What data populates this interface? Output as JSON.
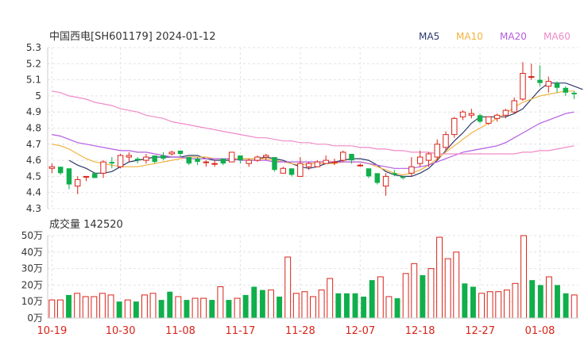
{
  "header": {
    "title": "中国西电[SH601179] 2024-01-12"
  },
  "legend": [
    {
      "label": "MA5",
      "color": "#2f3a6b"
    },
    {
      "label": "MA10",
      "color": "#f2b33d"
    },
    {
      "label": "MA20",
      "color": "#b45de0"
    },
    {
      "label": "MA60",
      "color": "#f08ac9"
    }
  ],
  "volume_panel": {
    "title": "成交量 142520"
  },
  "colors": {
    "up": "#d9241a",
    "down": "#0faf4b"
  },
  "chart_data": [
    {
      "type": "candlestick",
      "ylim": [
        4.3,
        5.3
      ],
      "y_ticks": [
        "5.3",
        "5.2",
        "5.1",
        "5",
        "4.9",
        "4.8",
        "4.7",
        "4.6",
        "4.5",
        "4.4",
        "4.3"
      ],
      "x_tick_labels": [
        "10-19",
        "10-30",
        "11-08",
        "11-17",
        "11-28",
        "12-07",
        "12-18",
        "12-27",
        "01-08"
      ],
      "x_tick_indices": [
        0,
        8,
        15,
        22,
        29,
        36,
        43,
        50,
        57
      ],
      "ohlc": [
        [
          4.55,
          4.58,
          4.52,
          4.56
        ],
        [
          4.56,
          4.55,
          4.51,
          4.52
        ],
        [
          4.55,
          4.47,
          4.42,
          4.45
        ],
        [
          4.44,
          4.5,
          4.39,
          4.48
        ],
        [
          4.5,
          4.5,
          4.47,
          4.5
        ],
        [
          4.52,
          4.52,
          4.49,
          4.49
        ],
        [
          4.52,
          4.6,
          4.49,
          4.59
        ],
        [
          4.59,
          4.62,
          4.55,
          4.58
        ],
        [
          4.56,
          4.64,
          4.55,
          4.63
        ],
        [
          4.62,
          4.65,
          4.59,
          4.63
        ],
        [
          4.61,
          4.62,
          4.58,
          4.6
        ],
        [
          4.6,
          4.64,
          4.58,
          4.62
        ],
        [
          4.63,
          4.63,
          4.58,
          4.59
        ],
        [
          4.63,
          4.65,
          4.6,
          4.61
        ],
        [
          4.64,
          4.66,
          4.63,
          4.65
        ],
        [
          4.66,
          4.66,
          4.62,
          4.64
        ],
        [
          4.62,
          4.62,
          4.57,
          4.58
        ],
        [
          4.61,
          4.62,
          4.57,
          4.59
        ],
        [
          4.59,
          4.6,
          4.56,
          4.59
        ],
        [
          4.58,
          4.6,
          4.56,
          4.58
        ],
        [
          4.61,
          4.61,
          4.57,
          4.58
        ],
        [
          4.59,
          4.65,
          4.59,
          4.65
        ],
        [
          4.63,
          4.63,
          4.58,
          4.6
        ],
        [
          4.58,
          4.61,
          4.56,
          4.6
        ],
        [
          4.6,
          4.63,
          4.59,
          4.62
        ],
        [
          4.62,
          4.64,
          4.6,
          4.63
        ],
        [
          4.62,
          4.62,
          4.53,
          4.54
        ],
        [
          4.52,
          4.56,
          4.52,
          4.55
        ],
        [
          4.55,
          4.55,
          4.5,
          4.51
        ],
        [
          4.5,
          4.62,
          4.5,
          4.58
        ],
        [
          4.56,
          4.59,
          4.54,
          4.58
        ],
        [
          4.56,
          4.6,
          4.56,
          4.59
        ],
        [
          4.58,
          4.63,
          4.58,
          4.6
        ],
        [
          4.59,
          4.61,
          4.57,
          4.59
        ],
        [
          4.6,
          4.66,
          4.59,
          4.65
        ],
        [
          4.64,
          4.64,
          4.58,
          4.6
        ],
        [
          4.57,
          4.58,
          4.56,
          4.57
        ],
        [
          4.55,
          4.55,
          4.49,
          4.5
        ],
        [
          4.52,
          4.52,
          4.45,
          4.46
        ],
        [
          4.44,
          4.52,
          4.38,
          4.5
        ],
        [
          4.52,
          4.54,
          4.5,
          4.51
        ],
        [
          4.5,
          4.5,
          4.48,
          4.49
        ],
        [
          4.52,
          4.62,
          4.5,
          4.56
        ],
        [
          4.58,
          4.66,
          4.56,
          4.62
        ],
        [
          4.6,
          4.65,
          4.56,
          4.64
        ],
        [
          4.62,
          4.73,
          4.6,
          4.7
        ],
        [
          4.68,
          4.78,
          4.66,
          4.76
        ],
        [
          4.76,
          4.87,
          4.74,
          4.86
        ],
        [
          4.87,
          4.91,
          4.85,
          4.9
        ],
        [
          4.88,
          4.92,
          4.86,
          4.89
        ],
        [
          4.88,
          4.89,
          4.83,
          4.84
        ],
        [
          4.83,
          4.87,
          4.82,
          4.87
        ],
        [
          4.86,
          4.89,
          4.84,
          4.88
        ],
        [
          4.88,
          4.92,
          4.86,
          4.91
        ],
        [
          4.9,
          4.99,
          4.89,
          4.97
        ],
        [
          4.98,
          5.21,
          4.97,
          5.14
        ],
        [
          5.12,
          5.2,
          5.1,
          5.12
        ],
        [
          5.1,
          5.19,
          5.06,
          5.08
        ],
        [
          5.06,
          5.12,
          5.02,
          5.09
        ],
        [
          5.08,
          5.09,
          5.02,
          5.05
        ],
        [
          5.05,
          5.06,
          5.0,
          5.02
        ],
        [
          5.02,
          5.03,
          4.98,
          5.01
        ]
      ],
      "ma": {
        "MA5": {
          "start": 2,
          "values": [
            4.6,
            4.57,
            4.55,
            4.52,
            4.52,
            4.53,
            4.56,
            4.59,
            4.6,
            4.61,
            4.62,
            4.62,
            4.62,
            4.62,
            4.63,
            4.63,
            4.61,
            4.6,
            4.6,
            4.6,
            4.61,
            4.61,
            4.61,
            4.62,
            4.61,
            4.6,
            4.58,
            4.56,
            4.55,
            4.56,
            4.58,
            4.59,
            4.6,
            4.61,
            4.61,
            4.6,
            4.57,
            4.53,
            4.51,
            4.5,
            4.5,
            4.52,
            4.55,
            4.6,
            4.66,
            4.72,
            4.77,
            4.83,
            4.87,
            4.87,
            4.87,
            4.87,
            4.89,
            4.92,
            4.98,
            5.04,
            5.08,
            5.08,
            5.08,
            5.06,
            5.04
          ]
        },
        "MA10": {
          "start": 0,
          "values": [
            4.7,
            4.69,
            4.67,
            4.64,
            4.61,
            4.59,
            4.58,
            4.57,
            4.56,
            4.56,
            4.56,
            4.57,
            4.58,
            4.59,
            4.6,
            4.61,
            4.62,
            4.62,
            4.62,
            4.61,
            4.61,
            4.61,
            4.61,
            4.61,
            4.61,
            4.61,
            4.6,
            4.59,
            4.58,
            4.57,
            4.58,
            4.58,
            4.58,
            4.58,
            4.59,
            4.59,
            4.59,
            4.58,
            4.56,
            4.54,
            4.52,
            4.51,
            4.52,
            4.54,
            4.57,
            4.61,
            4.65,
            4.69,
            4.73,
            4.77,
            4.8,
            4.83,
            4.86,
            4.89,
            4.93,
            4.96,
            4.98,
            5.0,
            5.01,
            5.02,
            5.03,
            5.03
          ]
        },
        "MA20": {
          "start": 0,
          "values": [
            4.76,
            4.75,
            4.73,
            4.71,
            4.7,
            4.69,
            4.68,
            4.67,
            4.66,
            4.66,
            4.65,
            4.65,
            4.64,
            4.63,
            4.62,
            4.62,
            4.61,
            4.61,
            4.61,
            4.61,
            4.61,
            4.61,
            4.6,
            4.6,
            4.6,
            4.6,
            4.59,
            4.59,
            4.59,
            4.59,
            4.59,
            4.59,
            4.59,
            4.59,
            4.59,
            4.59,
            4.59,
            4.58,
            4.57,
            4.56,
            4.55,
            4.55,
            4.55,
            4.56,
            4.57,
            4.59,
            4.61,
            4.63,
            4.65,
            4.66,
            4.67,
            4.68,
            4.69,
            4.71,
            4.74,
            4.77,
            4.8,
            4.83,
            4.85,
            4.87,
            4.89,
            4.9
          ]
        },
        "MA60": {
          "start": 0,
          "values": [
            5.03,
            5.02,
            5.0,
            4.99,
            4.98,
            4.96,
            4.95,
            4.94,
            4.92,
            4.91,
            4.9,
            4.88,
            4.87,
            4.86,
            4.84,
            4.83,
            4.82,
            4.81,
            4.8,
            4.79,
            4.78,
            4.77,
            4.76,
            4.75,
            4.74,
            4.74,
            4.73,
            4.72,
            4.72,
            4.71,
            4.71,
            4.7,
            4.7,
            4.69,
            4.69,
            4.69,
            4.68,
            4.68,
            4.67,
            4.67,
            4.66,
            4.66,
            4.65,
            4.65,
            4.65,
            4.64,
            4.64,
            4.64,
            4.64,
            4.64,
            4.64,
            4.64,
            4.64,
            4.64,
            4.64,
            4.65,
            4.65,
            4.66,
            4.66,
            4.67,
            4.68,
            4.69
          ]
        }
      }
    },
    {
      "type": "bar",
      "title": "成交量 142520",
      "ylim": [
        0,
        50
      ],
      "y_ticks": [
        "50万",
        "40万",
        "30万",
        "20万",
        "10万",
        "0万"
      ],
      "values": [
        11,
        11,
        14,
        15,
        13,
        13,
        15,
        14,
        10,
        11,
        10,
        14,
        15,
        11,
        16,
        13,
        11,
        12,
        12,
        11,
        19,
        11,
        12,
        14,
        19,
        17,
        17,
        13,
        37,
        15,
        16,
        13,
        17,
        24,
        15,
        15,
        15,
        13,
        23,
        25,
        13,
        12,
        27,
        33,
        26,
        30,
        49,
        36,
        40,
        21,
        19,
        15,
        16,
        16,
        17,
        21,
        50,
        23,
        20,
        25,
        20,
        15,
        14
      ],
      "up": [
        true,
        true,
        false,
        true,
        true,
        true,
        true,
        true,
        false,
        true,
        false,
        true,
        true,
        false,
        false,
        true,
        false,
        true,
        true,
        false,
        true,
        false,
        true,
        false,
        false,
        false,
        true,
        false,
        true,
        true,
        true,
        true,
        true,
        true,
        false,
        false,
        false,
        false,
        false,
        true,
        true,
        false,
        true,
        true,
        false,
        true,
        true,
        true,
        true,
        false,
        false,
        true,
        true,
        true,
        true,
        true,
        true,
        false,
        false,
        true,
        false,
        false,
        true
      ]
    }
  ]
}
